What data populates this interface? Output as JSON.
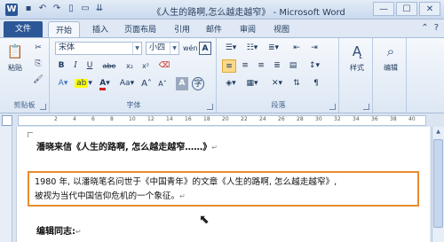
{
  "titlebar": {
    "app_logo": "W",
    "title": "《人生的路啊,怎么越走越窄》 - Microsoft Word",
    "qat_icons": [
      "save-icon",
      "undo-icon",
      "redo-icon",
      "new-doc-icon",
      "open-icon"
    ],
    "window_controls": [
      "—",
      "☐",
      "✕"
    ]
  },
  "tabs": {
    "file": "文件",
    "items": [
      "开始",
      "插入",
      "页面布局",
      "引用",
      "邮件",
      "审阅",
      "视图"
    ],
    "active": "开始"
  },
  "ribbon": {
    "clipboard": {
      "paste": "粘贴",
      "label": "剪贴板"
    },
    "font": {
      "font_name": "宋体",
      "font_size": "小四",
      "wen": "wén",
      "bold": "B",
      "italic": "I",
      "underline": "U",
      "strike": "abe",
      "sub": "x₂",
      "sup": "x²",
      "grow": "A",
      "shrink": "A",
      "aa": "Aa",
      "label": "字体"
    },
    "paragraph": {
      "label": "段落"
    },
    "styles": {
      "label": "样式"
    },
    "editing": {
      "label": "编辑"
    }
  },
  "ruler": {
    "ticks": [
      "2",
      "4",
      "6",
      "8",
      "10",
      "12",
      "14",
      "16",
      "18",
      "20",
      "22",
      "24",
      "26",
      "28",
      "30",
      "32",
      "34",
      "36",
      "38",
      "40"
    ]
  },
  "document": {
    "line1": "潘晓来信《人生的路啊, 怎么越走越窄……》",
    "para_line1": "1980 年, 以潘晓笔名问世于《中国青年》的文章《人生的路啊, 怎么越走越窄》,",
    "para_line2": "被视为当代中国信仰危机的一个象征。",
    "line3": "编辑同志:",
    "paragraph_mark": "↵"
  }
}
